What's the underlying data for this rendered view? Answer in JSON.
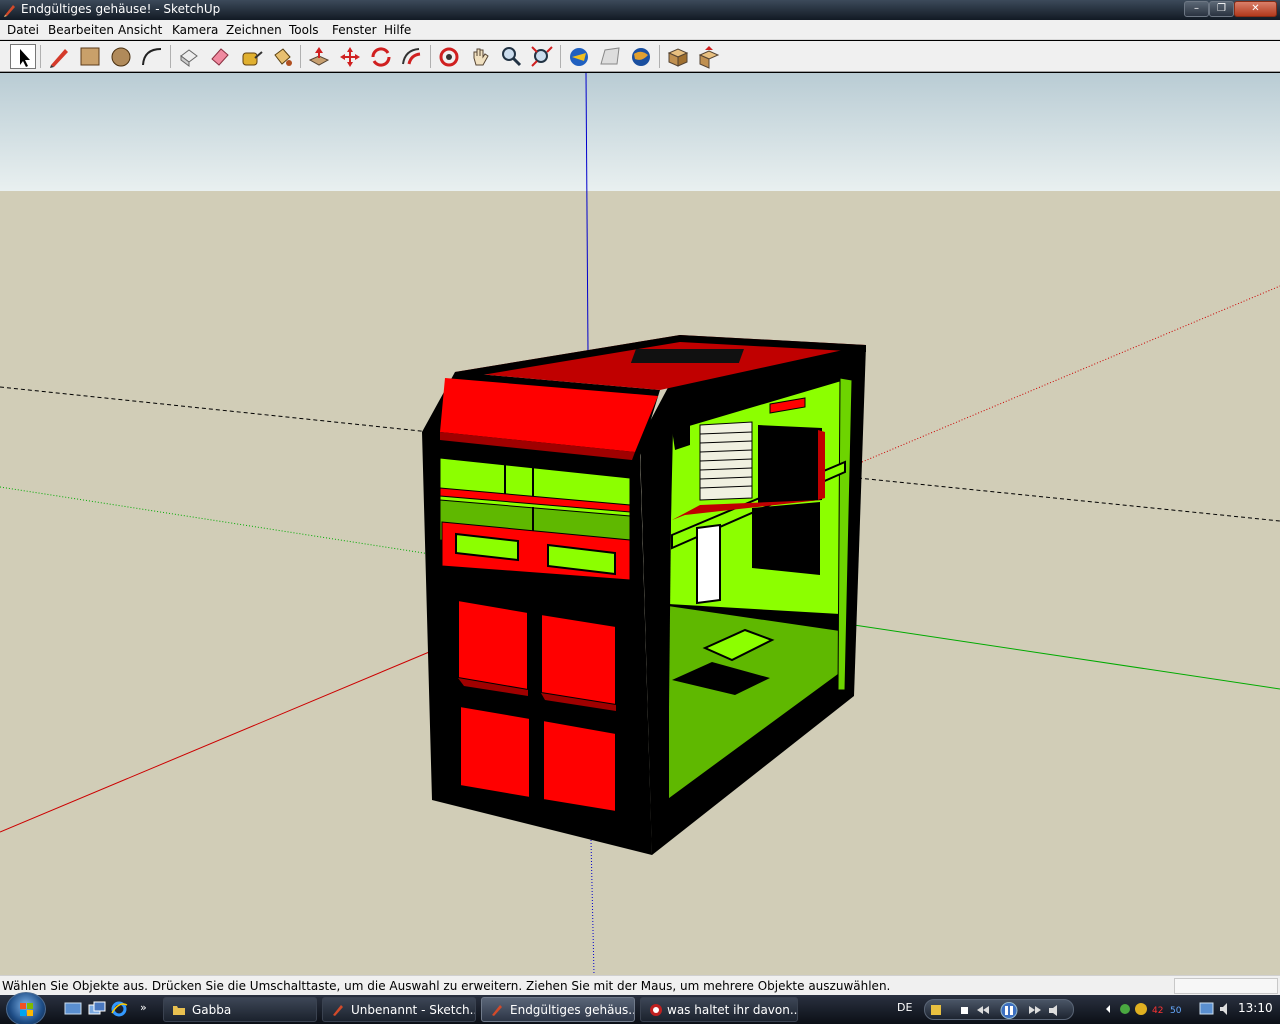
{
  "window": {
    "title": "Endgültiges gehäuse! - SketchUp",
    "minimize_label": "–",
    "maximize_label": "❐",
    "close_label": "✕"
  },
  "menu": {
    "items": [
      {
        "label": "Datei"
      },
      {
        "label": "Bearbeiten"
      },
      {
        "label": "Ansicht"
      },
      {
        "label": "Kamera"
      },
      {
        "label": "Zeichnen"
      },
      {
        "label": "Tools"
      },
      {
        "label": "Fenster"
      },
      {
        "label": "Hilfe"
      }
    ]
  },
  "toolbar": {
    "tools": [
      {
        "icon": "select-arrow-icon",
        "active": true
      },
      {
        "icon": "pencil-line-icon"
      },
      {
        "icon": "rectangle-icon"
      },
      {
        "icon": "circle-icon"
      },
      {
        "icon": "arc-icon"
      },
      {
        "icon": "make-component-icon"
      },
      {
        "icon": "eraser-icon"
      },
      {
        "icon": "tape-measure-icon"
      },
      {
        "icon": "paint-bucket-icon"
      },
      {
        "icon": "push-pull-icon"
      },
      {
        "icon": "move-icon"
      },
      {
        "icon": "rotate-icon"
      },
      {
        "icon": "follow-me-icon"
      },
      {
        "icon": "orbit-icon"
      },
      {
        "icon": "pan-hand-icon"
      },
      {
        "icon": "zoom-icon"
      },
      {
        "icon": "zoom-extents-icon"
      },
      {
        "icon": "get-models-icon"
      },
      {
        "icon": "share-model-icon"
      },
      {
        "icon": "google-earth-icon"
      },
      {
        "icon": "components-icon"
      },
      {
        "icon": "share-component-icon"
      }
    ]
  },
  "colors": {
    "sky": "#e7eff0",
    "ground": "#d1cdb7",
    "case_black": "#000000",
    "case_red": "#ff0000",
    "case_dark_red": "#c00000",
    "case_green": "#8cff00",
    "case_dark_green": "#5fb800",
    "axis_red": "#cc0000",
    "axis_green": "#00aa00",
    "axis_blue": "#0000cc"
  },
  "status": {
    "text": "Wählen Sie Objekte aus. Drücken Sie die Umschalttaste, um die Auswahl zu erweitern. Ziehen Sie mit der Maus, um mehrere Objekte auszuwählen."
  },
  "taskbar": {
    "tasks": [
      {
        "label": "Gabba",
        "icon": "folder-icon"
      },
      {
        "label": "Unbenannt - Sketch...",
        "icon": "sketchup-icon"
      },
      {
        "label": "Endgültiges gehäus...",
        "icon": "sketchup-icon",
        "current": true
      },
      {
        "label": "was haltet ihr davon...",
        "icon": "browser-icon"
      }
    ],
    "language": "DE",
    "clock": "13:10"
  }
}
